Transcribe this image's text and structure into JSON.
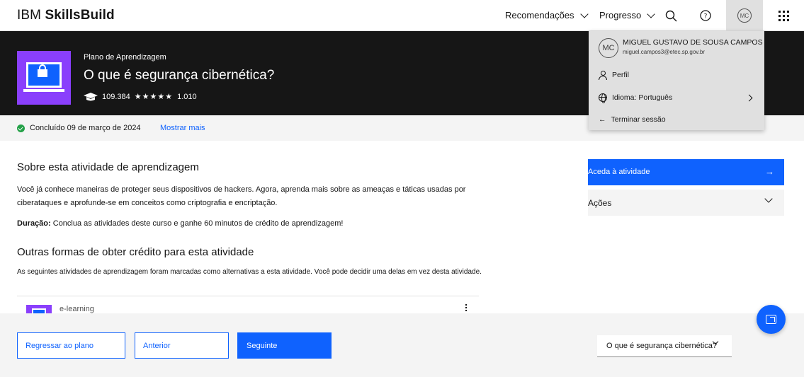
{
  "header": {
    "brand_light": "IBM ",
    "brand_bold": "SkillsBuild",
    "nav_recommendations": "Recomendações",
    "nav_progress": "Progresso",
    "avatar_initials": "MC"
  },
  "hero": {
    "eyebrow": "Plano de Aprendizagem",
    "title": "O que é segurança cibernética?",
    "learners": "109.384",
    "stars": "★★★★★",
    "ratings": "1.010"
  },
  "status": {
    "completed": "Concluído 09 de março de 2024",
    "show_more": "Mostrar mais"
  },
  "about": {
    "title": "Sobre esta atividade de aprendizagem",
    "description": "Você já conhece maneiras de proteger seus dispositivos de hackers. Agora, aprenda mais sobre as ameaças e táticas usadas por ciberataques e aprofunde-se em conceitos como criptografia e encriptação.",
    "duration_label": "Duração:",
    "duration_text": " Conclua as atividades deste curso e ganhe 60 minutos de crédito de aprendizagem!"
  },
  "alternatives": {
    "title": "Outras formas de obter crédito para esta atividade",
    "description": "As seguintes atividades de aprendizagem foram marcadas como alternativas a esta atividade. Você pode decidir uma delas em vez desta atividade.",
    "item_type": "e-learning"
  },
  "sidebar": {
    "cta_label": "Aceda à atividade",
    "cta_arrow": "→",
    "actions_label": "Ações"
  },
  "footer": {
    "back_label": "Regressar ao plano",
    "prev_label": "Anterior",
    "next_label": "Seguinte",
    "select_value": "O que é segurança cibernética?"
  },
  "profile_menu": {
    "initials": "MC",
    "name": "MIGUEL GUSTAVO DE SOUSA CAMPOS",
    "email": "miguel.campos3@etec.sp.gov.br",
    "profile_label": "Perfil",
    "language_label": "Idioma: Português",
    "logout_label": "Terminar sessão",
    "logout_arrow": "←"
  },
  "icons": {
    "search": "search-icon",
    "help": "help-icon",
    "apps": "app-switcher-icon",
    "chat": "chat-icon"
  },
  "colors": {
    "primary": "#0f62fe",
    "hero_bg": "#161616",
    "thumb": "#8a3ffc",
    "success": "#24a148"
  }
}
